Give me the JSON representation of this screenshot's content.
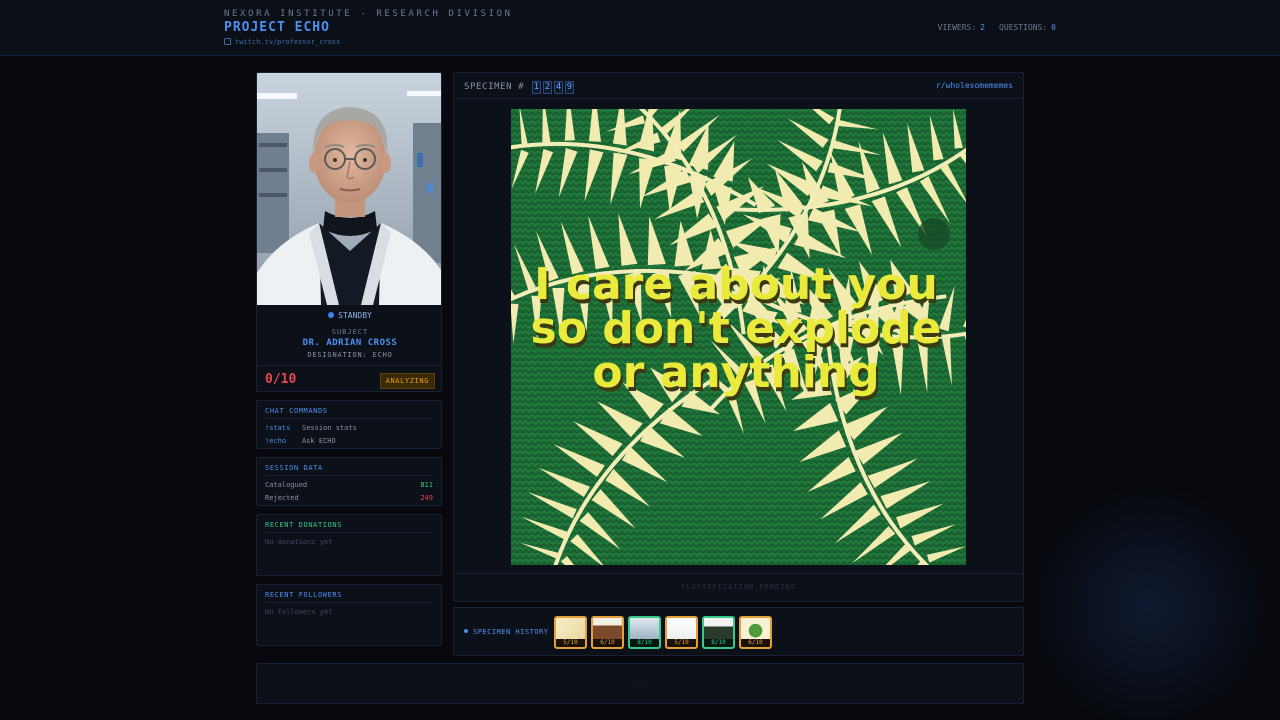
{
  "header": {
    "org": "NEXORA INSTITUTE - RESEARCH DIVISION",
    "title": "PROJECT ECHO",
    "link": "twitch.tv/professor_cross",
    "viewers_label": "VIEWERS:",
    "viewers": "2",
    "questions_label": "QUESTIONS:",
    "questions": "0"
  },
  "subject": {
    "status": "STANDBY",
    "label": "SUBJECT",
    "name": "DR. ADRIAN CROSS",
    "designation": "DESIGNATION: ECHO",
    "score": "0/10",
    "analyzing": "ANALYZING"
  },
  "chat_commands": {
    "title": "CHAT COMMANDS",
    "items": [
      {
        "cmd": "!stats",
        "desc": "Session stats"
      },
      {
        "cmd": "!echo",
        "desc": "Ask ECHO"
      }
    ]
  },
  "session_data": {
    "title": "SESSION DATA",
    "catalogued_label": "Catalogued",
    "catalogued": "811",
    "rejected_label": "Rejected",
    "rejected": "249"
  },
  "donations": {
    "title": "RECENT DONATIONS",
    "empty": "No donations yet"
  },
  "followers": {
    "title": "RECENT FOLLOWERS",
    "empty": "No followers yet"
  },
  "specimen": {
    "label": "SPECIMEN #",
    "digits": [
      "1",
      "2",
      "4",
      "9"
    ],
    "subreddit": "r/wholesomememes",
    "meme_lines": [
      "I care about you",
      "so don't explode",
      "or anything"
    ],
    "status": "CLASSIFICATION PENDING"
  },
  "history": {
    "label": "SPECIMEN HISTORY",
    "thumbs": [
      {
        "score": "5/10",
        "tone": "amber"
      },
      {
        "score": "6/10",
        "tone": "amber"
      },
      {
        "score": "8/10",
        "tone": "green"
      },
      {
        "score": "5/10",
        "tone": "amber"
      },
      {
        "score": "8/10",
        "tone": "green"
      },
      {
        "score": "6/10",
        "tone": "amber"
      }
    ]
  },
  "footer": {
    "text": "..."
  },
  "colors": {
    "accent": "#4d8ff0",
    "score_red": "#e5484d",
    "good_green": "#36c98a",
    "warn_amber": "#e2a13a"
  }
}
